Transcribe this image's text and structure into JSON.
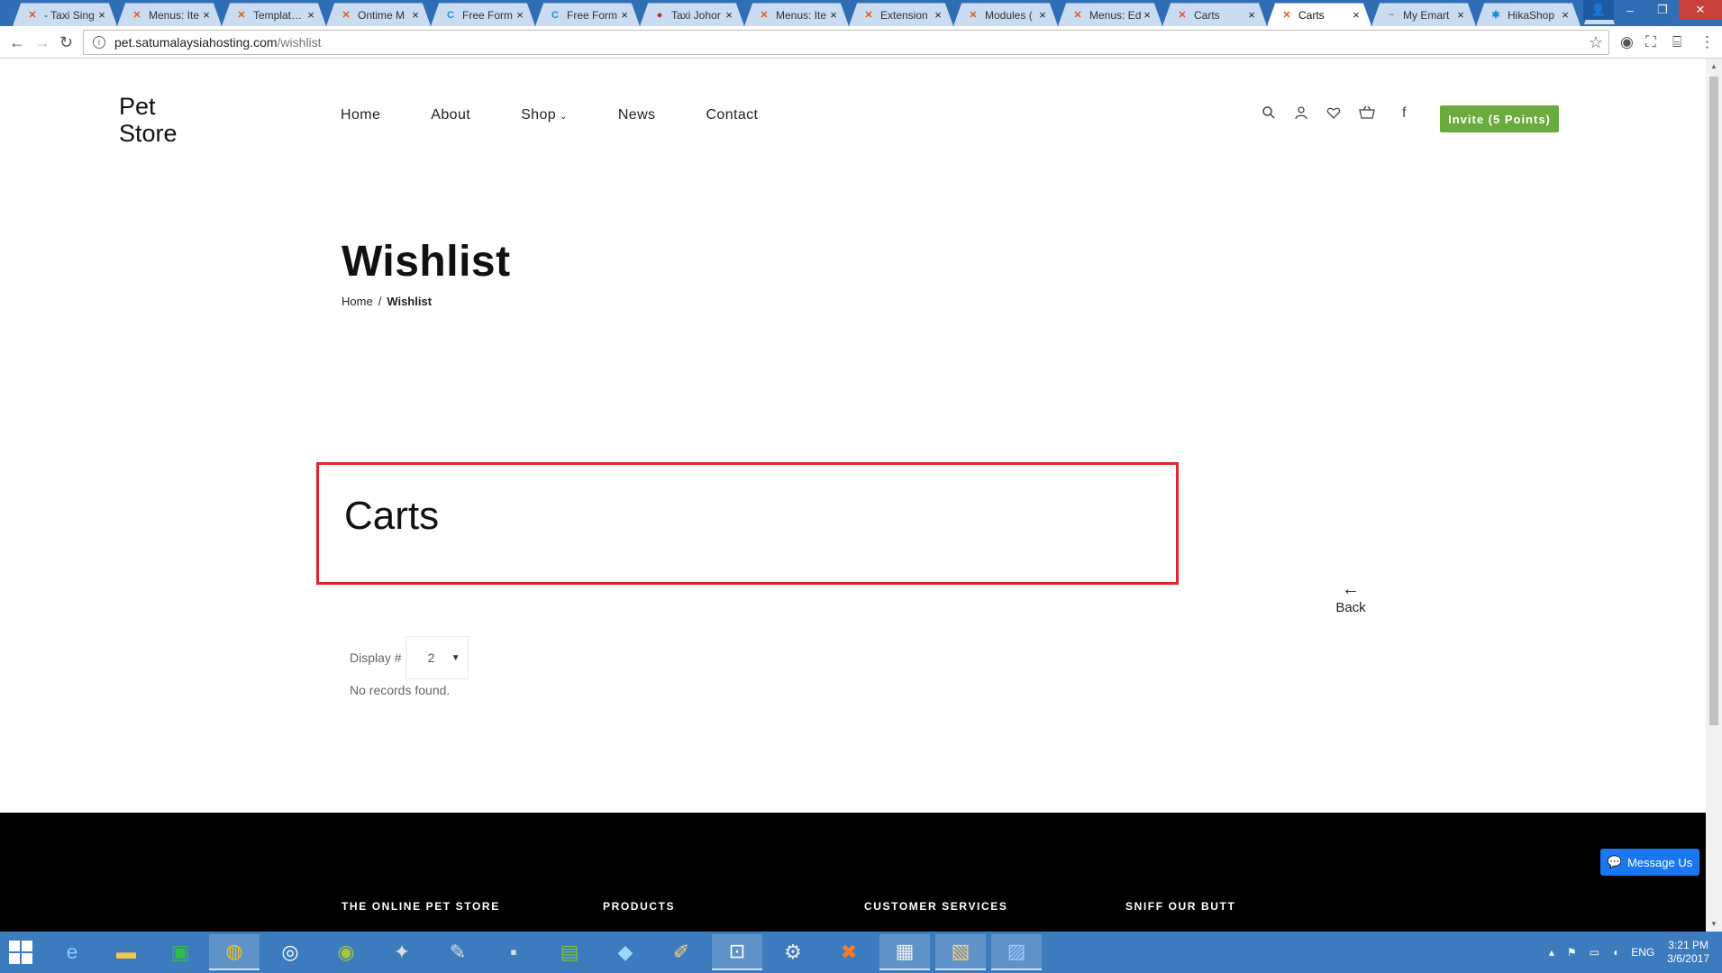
{
  "browser": {
    "tabs": [
      {
        "label": "- Taxi Sing",
        "icon": "joomla-icon"
      },
      {
        "label": "Menus: Ite",
        "icon": "joomla-icon"
      },
      {
        "label": "Templates:",
        "icon": "joomla-icon"
      },
      {
        "label": "Ontime M",
        "icon": "joomla-icon"
      },
      {
        "label": "Free Form",
        "icon": "c-icon"
      },
      {
        "label": "Free Form",
        "icon": "c-icon"
      },
      {
        "label": "Taxi Johor",
        "icon": "site-icon"
      },
      {
        "label": "Menus: Ite",
        "icon": "joomla-icon"
      },
      {
        "label": "Extension",
        "icon": "joomla-icon"
      },
      {
        "label": "Modules (",
        "icon": "joomla-icon"
      },
      {
        "label": "Menus: Ed",
        "icon": "joomla-icon"
      },
      {
        "label": "Carts",
        "icon": "joomla-icon"
      },
      {
        "label": "Carts",
        "icon": "joomla-icon",
        "active": true
      },
      {
        "label": "My Emart",
        "icon": "emart-icon"
      },
      {
        "label": "HikaShop",
        "icon": "hikashop-icon"
      }
    ],
    "url_host": "pet.satumalaysiahosting.com",
    "url_path": "/wishlist"
  },
  "site": {
    "logo_line1": "Pet",
    "logo_line2": "Store",
    "nav": {
      "home": "Home",
      "about": "About",
      "shop": "Shop",
      "news": "News",
      "contact": "Contact"
    },
    "invite_label": "Invite (5 Points)"
  },
  "main": {
    "title": "Wishlist",
    "breadcrumb_home": "Home",
    "breadcrumb_sep": "/",
    "breadcrumb_current": "Wishlist",
    "carts_heading": "Carts",
    "back_label": "Back",
    "display_label": "Display #",
    "display_value": "2",
    "no_records": "No records found."
  },
  "footer": {
    "col1": "THE ONLINE PET STORE",
    "col2": "PRODUCTS",
    "col3": "CUSTOMER SERVICES",
    "col4": "SNIFF OUR BUTT",
    "message_us": "Message Us"
  },
  "taskbar": {
    "lang": "ENG",
    "time": "3:21 PM",
    "date": "3/6/2017"
  },
  "colors": {
    "highlight_border": "#e3222b",
    "invite_bg": "#6aab3e",
    "taskbar": "#3d7bbf",
    "tabstrip": "#2f6db5",
    "messenger": "#1977f2"
  }
}
